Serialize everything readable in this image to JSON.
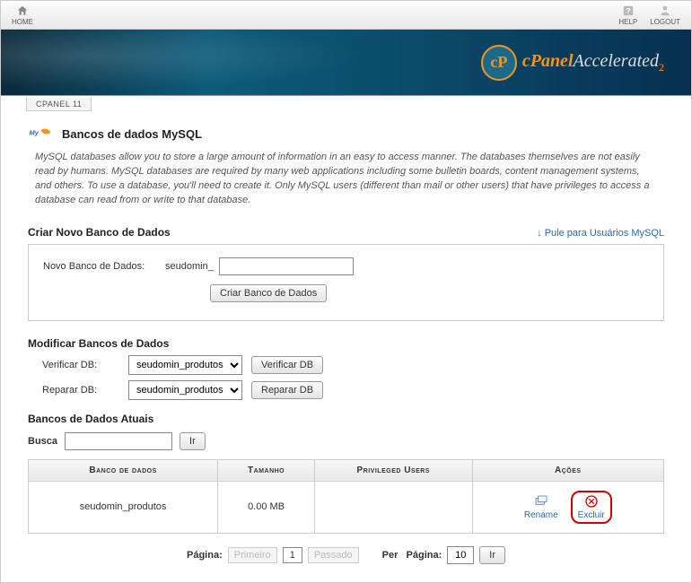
{
  "topbar": {
    "home": "HOME",
    "help": "HELP",
    "logout": "LOGOUT"
  },
  "banner": {
    "cp": "cP",
    "cpanel": "cPanel",
    "accel": "Accelerated",
    "sub": "2"
  },
  "crumb": "CPANEL 11",
  "page": {
    "title": "Bancos de dados MySQL",
    "intro": "MySQL databases allow you to store a large amount of information in an easy to access manner. The databases themselves are not easily read by humans. MySQL databases are required by many web applications including some bulletin boards, content management systems, and others. To use a database, you'll need to create it. Only MySQL users (different than mail or other users) that have privileges to access a database can read from or write to that database."
  },
  "create": {
    "section_title": "Criar Novo Banco de Dados",
    "jump_link": "Pule para Usuários MySQL",
    "field_label": "Novo Banco de Dados:",
    "prefix": "seudomin_",
    "value": "",
    "button": "Criar Banco de Dados"
  },
  "modify": {
    "section_title": "Modificar Bancos de Dados",
    "check_label": "Verificar DB:",
    "check_button": "Verificar DB",
    "repair_label": "Reparar DB:",
    "repair_button": "Reparar DB",
    "options": [
      "seudomin_produtos"
    ],
    "selected": "seudomin_produtos"
  },
  "current": {
    "section_title": "Bancos de Dados Atuais",
    "search_label": "Busca",
    "search_value": "",
    "go": "Ir",
    "columns": {
      "db": "Banco de dados",
      "size": "Tamanho",
      "users": "Privileged Users",
      "actions": "Ações"
    },
    "rows": [
      {
        "db": "seudomin_produtos",
        "size": "0.00 MB",
        "users": ""
      }
    ],
    "actions": {
      "rename": "Rename",
      "delete": "Excluir"
    }
  },
  "pager": {
    "page_label": "Página:",
    "first": "Primeiro",
    "current": "1",
    "last": "Passado",
    "per_label": "Per   Página:",
    "per_value": "10",
    "go": "Ir"
  }
}
